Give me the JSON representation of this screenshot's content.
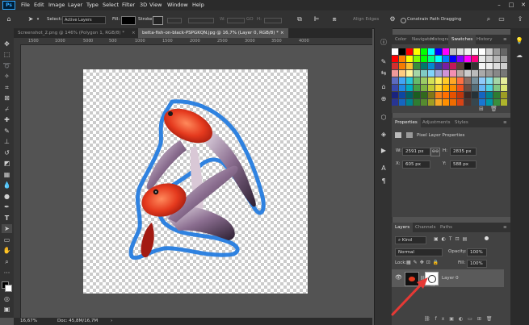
{
  "menubar": {
    "logo": "Ps",
    "items": [
      "File",
      "Edit",
      "Image",
      "Layer",
      "Type",
      "Select",
      "Filter",
      "3D",
      "View",
      "Window",
      "Help"
    ]
  },
  "options": {
    "select_label": "Select:",
    "select_value": "Active Layers",
    "fill_label": "Fill:",
    "stroke_label": "Stroke:",
    "align_edges": "Align Edges",
    "constrain_label": "Constrain Path Dragging"
  },
  "tabs": [
    {
      "label": "Screenshot_2.png @ 146% (Polygon 1, RGB/8) *",
      "close": "×"
    },
    {
      "label": "betta-fish-on-black-PSPGKQN.jpg @ 16,7% (Layer 0, RGB/8) *",
      "close": "×"
    }
  ],
  "ruler": {
    "h": [
      "1500",
      "1000",
      "500",
      "0",
      "500",
      "1000",
      "1500",
      "2000",
      "2500",
      "3000",
      "3500",
      "4000"
    ]
  },
  "status": {
    "zoom": "16,67%",
    "doc": "Doc: 45,8M/16,7M"
  },
  "swatches": {
    "tabs": [
      "Color",
      "Navigator",
      "Histogram",
      "Swatches",
      "History"
    ],
    "active": "Swatches"
  },
  "properties": {
    "tabs": [
      "Properties",
      "Adjustments",
      "Styles"
    ],
    "type_label": "Pixel Layer Properties",
    "w_label": "W:",
    "w_value": "2591 px",
    "h_label": "H:",
    "h_value": "2835 px",
    "x_label": "X:",
    "x_value": "605 px",
    "y_label": "Y:",
    "y_value": "588 px",
    "link_icon": "link-icon"
  },
  "layers": {
    "tabs": [
      "Layers",
      "Channels",
      "Paths"
    ],
    "filter_value": "Kind",
    "blend_mode": "Normal",
    "opacity_label": "Opacity:",
    "opacity_value": "100%",
    "lock_label": "Lock:",
    "fill_label": "Fill:",
    "fill_value": "100%",
    "layer_name": "Layer 0"
  },
  "colors": {
    "accent": "#1e88e5",
    "arrow": "#e53935",
    "outline": "#2f82e0",
    "fish_red": "#e53a1e"
  }
}
